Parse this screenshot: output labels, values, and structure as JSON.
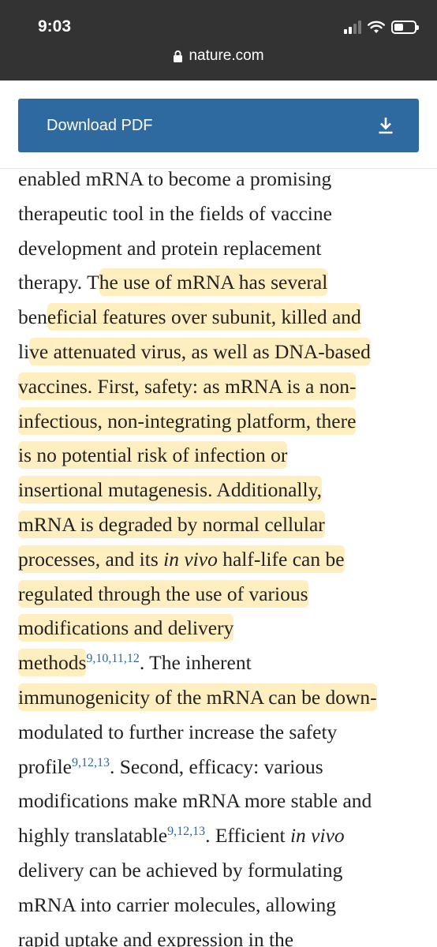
{
  "status_bar": {
    "time": "9:03",
    "signal_bars": 4,
    "signal_bars_filled": 2
  },
  "url_bar": {
    "domain": "nature.com",
    "icon": "lock-icon"
  },
  "download": {
    "label": "Download PDF",
    "icon": "download-icon",
    "color": "#2e6aa0"
  },
  "colors": {
    "highlight": "#ffd65a",
    "reference_link": "#2e6aa0",
    "text": "#222222",
    "topbar": "#333333"
  },
  "article": {
    "l1": "enabled mRNA to become a promising",
    "l2": "therapeutic tool in the fields of vaccine",
    "l3": "development and protein replacement",
    "l4a": "therapy. T",
    "l4b": "he use of mRNA has several",
    "l5a": "ben",
    "l5b": "eficial features over subunit, killed and",
    "l6a": "li",
    "l6b": "ve attenuated virus, as well as DNA-based",
    "l7a": "vaccines. First, safety: as mRNA is a non-",
    "l8a": "infectious, non-integrating platform, there",
    "l9a": "is no potential risk of infection or",
    "l10a": "insertional mutagenesis. Additionally,",
    "l11a": "mRNA is degraded by normal cellular",
    "l12a": "processes, and its ",
    "l12b": "in vivo",
    "l12c": " half-life can be",
    "l13a": "regulated through the use of various",
    "l14a": "modifications and delivery",
    "l15a": "methods",
    "l15refs": [
      "9",
      "10",
      "11",
      "12"
    ],
    "l15b": ". The inherent",
    "l16a": "immunogenicity of the mRNA can be down-",
    "l17a": "modulated to further increase the safety",
    "l18a": "profile",
    "l18refs": [
      "9",
      "12",
      "13"
    ],
    "l18b": ". Second, efficacy: various",
    "l19a": "modifications make mRNA more stable and",
    "l20a": "highly translatable",
    "l20refs": [
      "9",
      "12",
      "13"
    ],
    "l20b": ". Efficient ",
    "l20c": "in vivo",
    "l21a": "delivery can be achieved by formulating",
    "l22a": "mRNA into carrier molecules, allowing",
    "l23a": "rapid uptake and expression in the"
  }
}
